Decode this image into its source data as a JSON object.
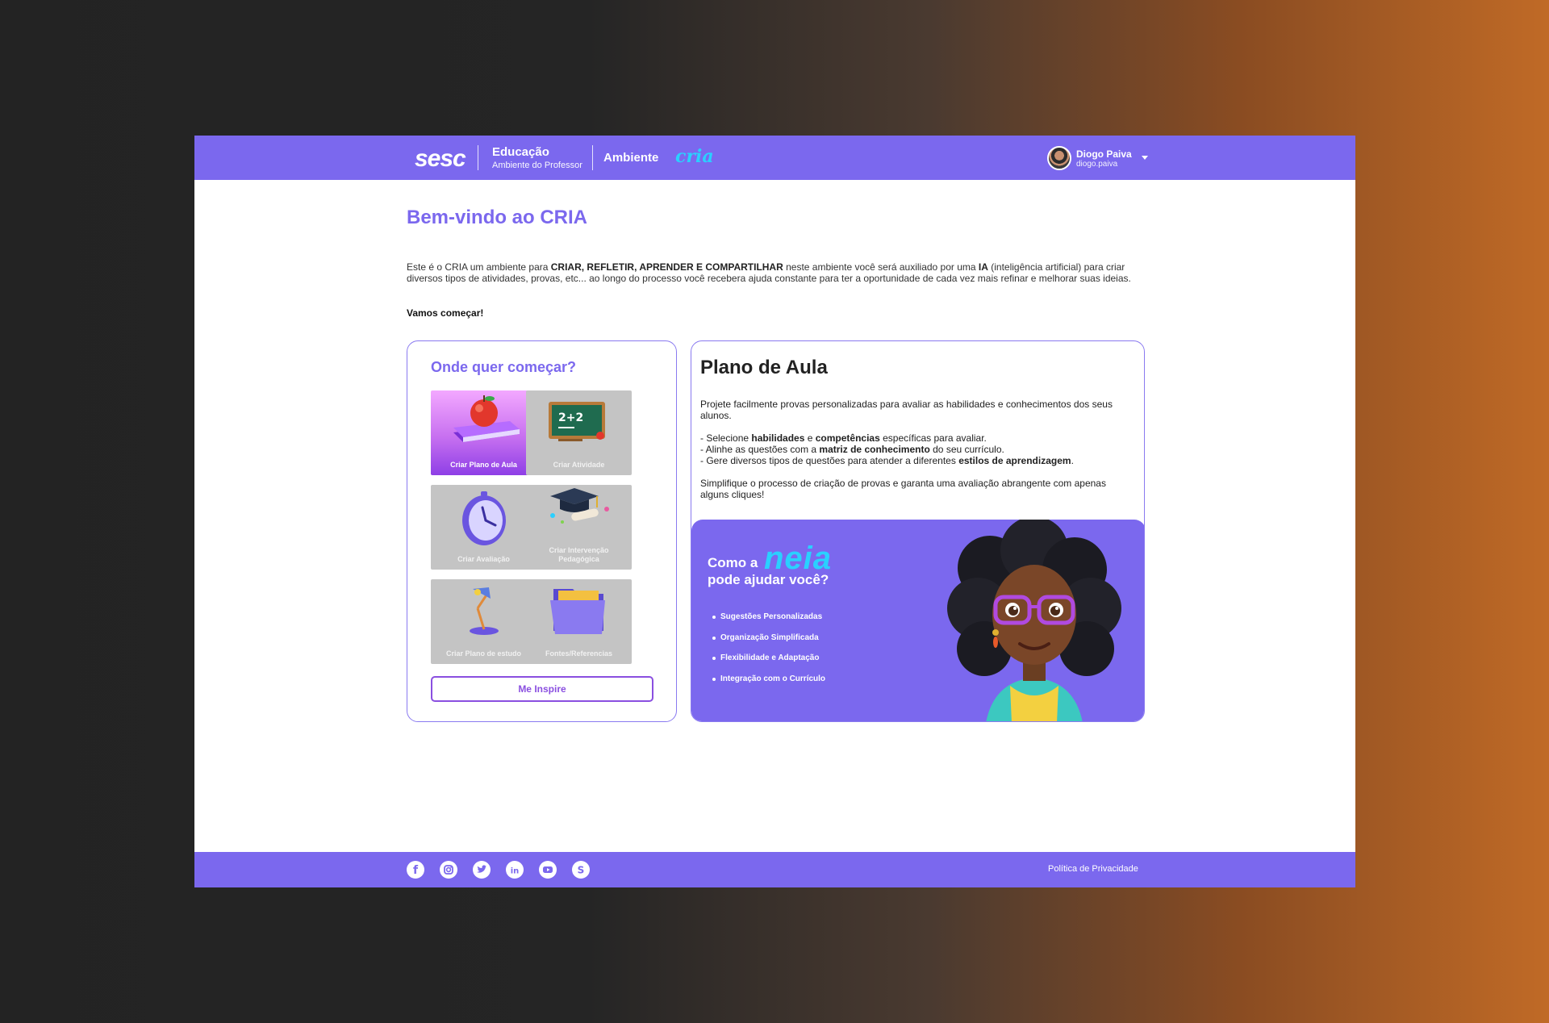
{
  "header": {
    "brand": "sesc",
    "section_title": "Educação",
    "section_subtitle": "Ambiente do Professor",
    "ambiente_label": "Ambiente",
    "cria_logo": "cria",
    "user": {
      "name": "Diogo Paiva",
      "login": "diogo.paiva"
    }
  },
  "main": {
    "title": "Bem-vindo ao CRIA",
    "intro": {
      "t1": "Este é o CRIA um ambiente para ",
      "b1": "CRIAR,  REFLETIR, APRENDER E COMPARTILHAR",
      "t2": " neste ambiente você será auxiliado por uma ",
      "b2": "IA",
      "t3": " (inteligência artificial) para criar diversos tipos de atividades, provas, etc... ao longo do processo você recebera ajuda constante para ter a oportunidade de cada vez mais refinar e melhorar suas ideias."
    },
    "cta": "Vamos começar!"
  },
  "start_card": {
    "title": "Onde quer começar?",
    "tiles": [
      {
        "label": "Criar Plano de Aula",
        "icon": "apple-book-icon"
      },
      {
        "label": "Criar Atividade",
        "icon": "chalkboard-icon"
      },
      {
        "label": "Criar Avaliação",
        "icon": "clock-icon"
      },
      {
        "label": "Criar Intervenção Pedagógica",
        "icon": "graduation-cap-icon"
      },
      {
        "label": "Criar Plano de estudo",
        "icon": "desk-lamp-icon"
      },
      {
        "label": "Fontes/Referencias",
        "icon": "folder-icon"
      }
    ],
    "inspire_button": "Me Inspire"
  },
  "plano": {
    "title": "Plano de Aula",
    "p1": "Projete facilmente provas personalizadas para avaliar as habilidades e conhecimentos dos seus alunos.",
    "l1a": "- Selecione ",
    "l1b": "habilidades",
    "l1c": " e ",
    "l1d": "competências",
    "l1e": " específicas para avaliar.",
    "l2a": "- Alinhe as questões com a ",
    "l2b": "matriz de conhecimento",
    "l2c": " do seu currículo.",
    "l3a": "- Gere diversos tipos de questões para atender a diferentes ",
    "l3b": "estilos de aprendizagem",
    "l3c": ".",
    "p3": "Simplifique o processo de criação de provas e garanta uma avaliação abrangente com apenas alguns cliques!"
  },
  "neia": {
    "q_part1": "Como a",
    "name": "neia",
    "q_part2": "pode ajudar você?",
    "features": [
      "Sugestões Personalizadas",
      "Organização Simplificada",
      "Flexibilidade e Adaptação",
      "Integração com o Currículo"
    ]
  },
  "footer": {
    "social": [
      "facebook-icon",
      "instagram-icon",
      "twitter-icon",
      "linkedin-icon",
      "youtube-icon",
      "sesc-icon"
    ],
    "privacy": "Política de Privacidade"
  },
  "colors": {
    "brand_purple": "#7b68ee",
    "neia_cyan": "#2ad0ff"
  }
}
